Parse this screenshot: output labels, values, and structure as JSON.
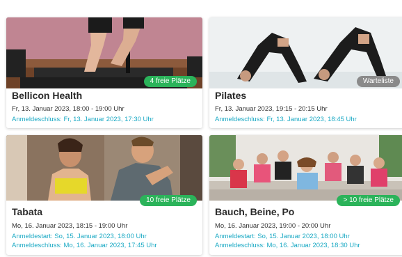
{
  "cards": [
    {
      "title": "Bellicon Health",
      "date": "Fr, 13. Januar 2023, 18:00 - 19:00 Uhr",
      "deadline": "Anmeldeschluss: Fr, 13. Januar 2023, 17:30 Uhr",
      "badge": "4 freie Plätze",
      "badge_color": "#2bb35a"
    },
    {
      "title": "Pilates",
      "date": "Fr, 13. Januar 2023, 19:15 - 20:15 Uhr",
      "deadline": "Anmeldeschluss: Fr, 13. Januar 2023, 18:45 Uhr",
      "badge": "Warteliste",
      "badge_color": "#8a8a8a"
    },
    {
      "title": "Tabata",
      "date": "Mo, 16. Januar 2023, 18:15 - 19:00 Uhr",
      "start": "Anmeldestart: So, 15. Januar 2023, 18:00 Uhr",
      "deadline": "Anmeldeschluss: Mo, 16. Januar 2023, 17:45 Uhr",
      "badge": "10 freie Plätze",
      "badge_color": "#2bb35a"
    },
    {
      "title": "Bauch, Beine, Po",
      "date": "Mo, 16. Januar 2023, 19:00 - 20:00 Uhr",
      "start": "Anmeldestart: So, 15. Januar 2023, 18:00 Uhr",
      "deadline": "Anmeldeschluss: Mo, 16. Januar 2023, 18:30 Uhr",
      "badge": "> 10 freie Plätze",
      "badge_color": "#2bb35a"
    }
  ],
  "colors": {
    "link": "#1aa9c4",
    "text": "#333333",
    "title": "#2a2a2a"
  }
}
